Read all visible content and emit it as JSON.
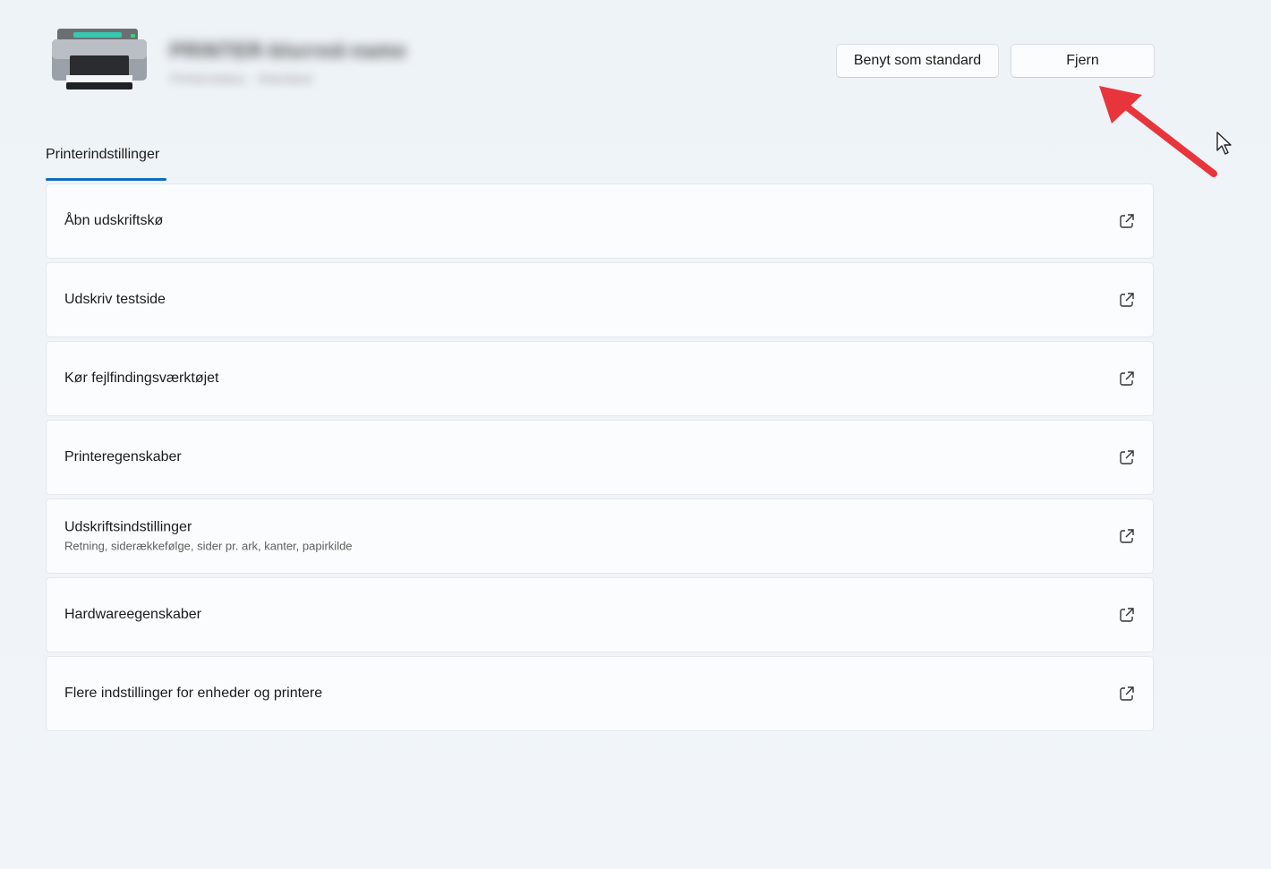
{
  "header": {
    "printer_name": "PRINTER-blurred-name",
    "printer_status": "Printerstatus · Standard",
    "set_default_label": "Benyt som standard",
    "remove_label": "Fjern"
  },
  "tabs": [
    {
      "label": "Printerindstillinger",
      "selected": true
    }
  ],
  "settings": [
    {
      "label": "Åbn udskriftskø",
      "icon": "open-external-icon"
    },
    {
      "label": "Udskriv testside",
      "icon": "open-external-icon"
    },
    {
      "label": "Kør fejlfindingsværktøjet",
      "icon": "open-external-icon"
    },
    {
      "label": "Printeregenskaber",
      "icon": "open-external-icon"
    },
    {
      "label": "Udskriftsindstillinger",
      "sublabel": "Retning, siderækkefølge, sider pr. ark, kanter, papirkilde",
      "icon": "open-external-icon"
    },
    {
      "label": "Hardwareegenskaber",
      "icon": "open-external-icon"
    },
    {
      "label": "Flere indstillinger for enheder og printere",
      "icon": "open-external-icon"
    }
  ],
  "colors": {
    "accent": "#0f6cbd",
    "annotation_arrow": "#e8353b",
    "background": "#eff4f9",
    "card": "#fbfcfd"
  }
}
